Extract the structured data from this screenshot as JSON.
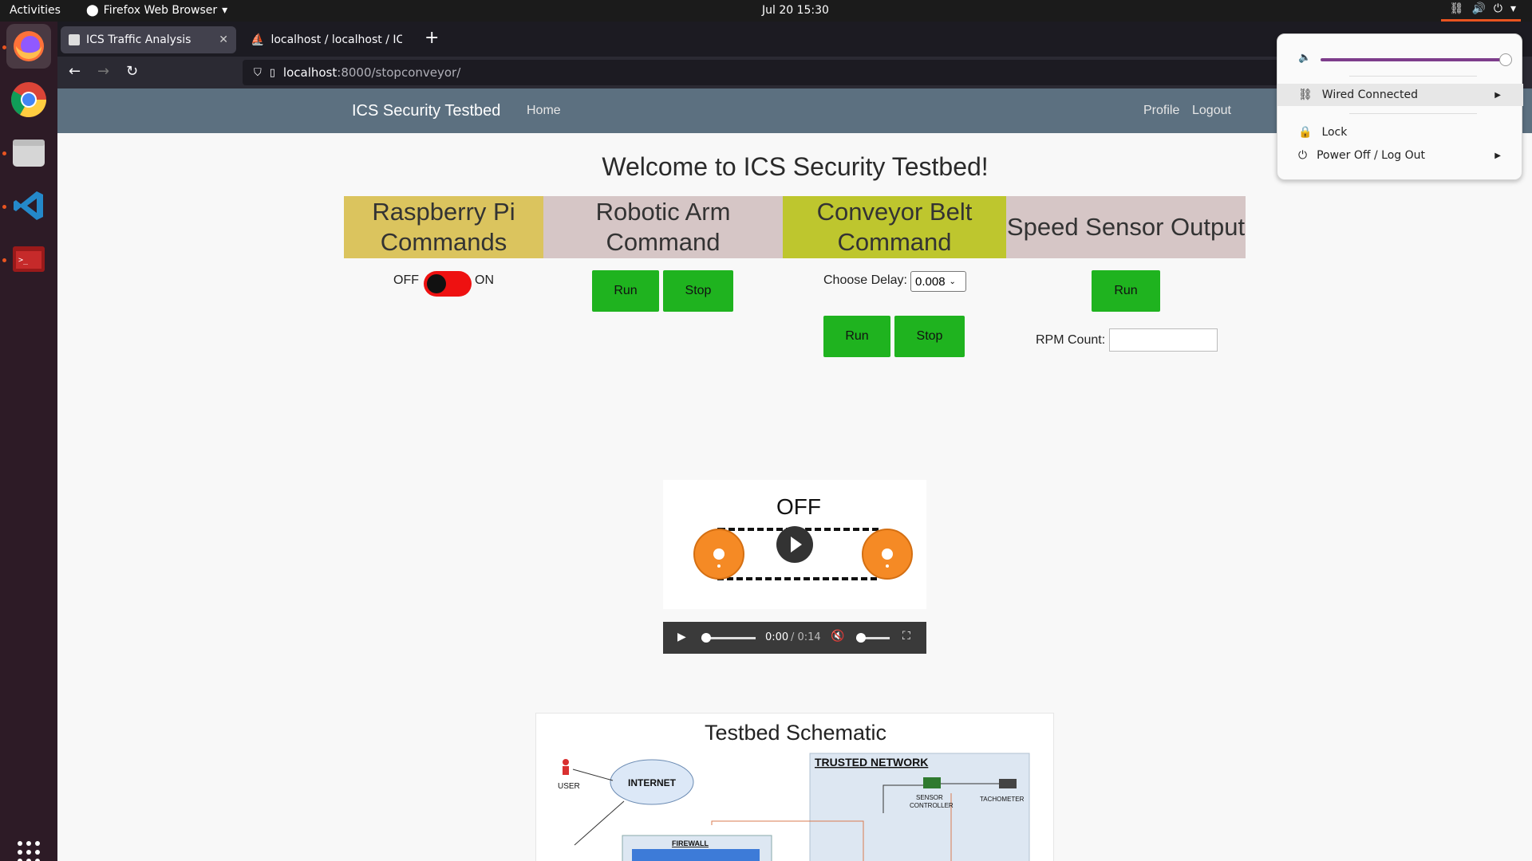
{
  "topbar": {
    "activities": "Activities",
    "app_name": "Firefox Web Browser",
    "clock": "Jul 20  15:30"
  },
  "browser": {
    "tabs": [
      {
        "title": "ICS Traffic Analysis",
        "icon": "page-icon"
      },
      {
        "title": "localhost / localhost / ICS",
        "icon": "phpmyadmin-icon"
      }
    ],
    "url_host": "localhost",
    "url_path": ":8000/stopconveyor/"
  },
  "site": {
    "brand": "ICS Security Testbed",
    "nav_home": "Home",
    "nav_profile": "Profile",
    "nav_logout": "Logout",
    "welcome": "Welcome to ICS Security Testbed!"
  },
  "columns": {
    "rpi": {
      "title": "Raspberry Pi Commands",
      "color": "#dbc45e",
      "off_label": "OFF",
      "on_label": "ON",
      "toggle_state": "off"
    },
    "arm": {
      "title": "Robotic Arm Command",
      "color": "#d6c6c6",
      "run": "Run",
      "stop": "Stop"
    },
    "conveyor": {
      "title": "Conveyor Belt Command",
      "color": "#bec62e",
      "delay_label": "Choose Delay:",
      "delay_value": "0.008",
      "run": "Run",
      "stop": "Stop"
    },
    "sensor": {
      "title": "Speed Sensor Output",
      "color": "#d6c6c6",
      "run": "Run",
      "rpm_label": "RPM Count:",
      "rpm_value": ""
    }
  },
  "video": {
    "state_text": "OFF",
    "time_current": "0:00",
    "time_total": "/ 0:14"
  },
  "schematic": {
    "title": "Testbed Schematic",
    "labels": {
      "user": "USER",
      "internet": "INTERNET",
      "firewall": "FIREWALL",
      "trusted": "TRUSTED NETWORK",
      "sensor_controller_1": "SENSOR",
      "sensor_controller_2": "CONTROLLER",
      "tachometer": "TACHOMETER"
    }
  },
  "status_menu": {
    "wired": "Wired Connected",
    "lock": "Lock",
    "power": "Power Off / Log Out",
    "volume_level": 0.97
  },
  "colors": {
    "accent": "#e95420",
    "header": "#5c7080",
    "button_green": "#1fb31f",
    "belt_orange": "#f58a25"
  }
}
